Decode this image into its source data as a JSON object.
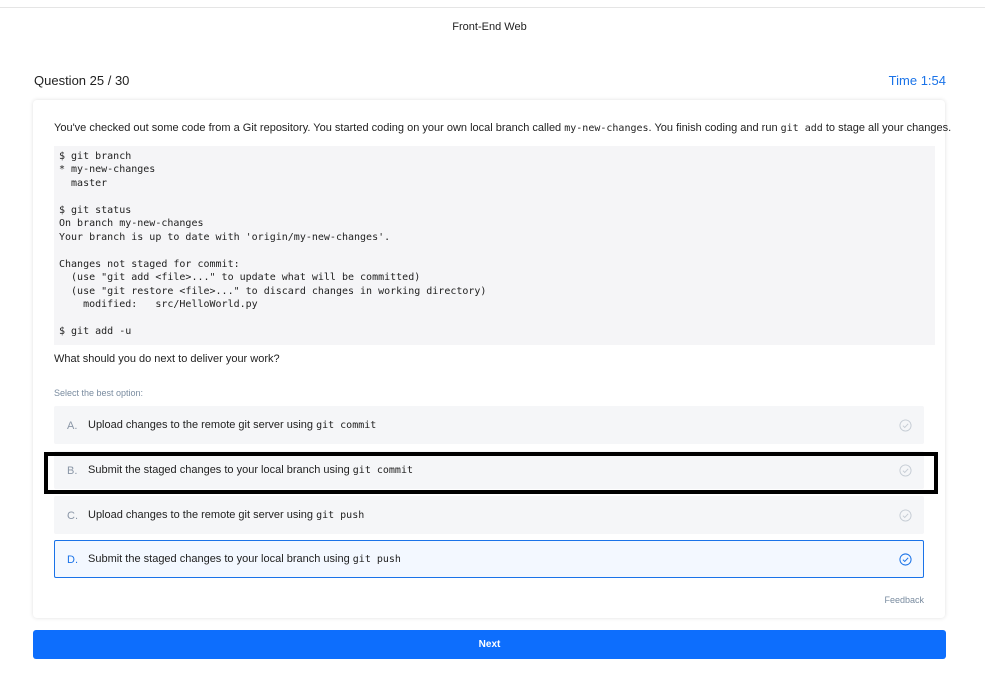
{
  "header": {
    "app_title": "Front-End Web",
    "question_counter": "Question 25 / 30",
    "timer": "Time 1:54"
  },
  "question": {
    "prompt_part1": "You've checked out some code from a Git repository. You started coding on your own local branch called ",
    "prompt_code1": "my-new-changes",
    "prompt_part2": ". You finish coding and run ",
    "prompt_code2": "git add",
    "prompt_part3": " to stage all your changes.",
    "code_block": "$ git branch\n* my-new-changes\n  master\n\n$ git status\nOn branch my-new-changes\nYour branch is up to date with 'origin/my-new-changes'.\n\nChanges not staged for commit:\n  (use \"git add <file>...\" to update what will be committed)\n  (use \"git restore <file>...\" to discard changes in working directory)\n    modified:   src/HelloWorld.py\n\n$ git add -u",
    "followup": "What should you do next to deliver your work?",
    "select_hint": "Select the best option:"
  },
  "options": [
    {
      "letter": "A.",
      "text": "Upload changes to the remote git server using ",
      "code": "git commit",
      "selected": false
    },
    {
      "letter": "B.",
      "text": "Submit the staged changes to your local branch using ",
      "code": "git commit",
      "selected": false
    },
    {
      "letter": "C.",
      "text": "Upload changes to the remote git server using ",
      "code": "git push",
      "selected": false
    },
    {
      "letter": "D.",
      "text": "Submit the staged changes to your local branch using ",
      "code": "git push",
      "selected": true
    }
  ],
  "footer": {
    "feedback_label": "Feedback",
    "next_label": "Next"
  },
  "colors": {
    "accent": "#1a73e8",
    "next_button": "#0d6efd",
    "option_bg": "#f5f6f8",
    "check_inactive": "#c5ccd4"
  },
  "icons": {
    "option_check": "check-circle-icon"
  }
}
